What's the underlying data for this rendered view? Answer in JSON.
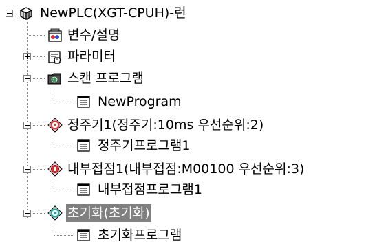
{
  "tree": {
    "root": {
      "label": "NewPLC(XGT-CPUH)-런",
      "icon": "plc-cube-icon"
    },
    "items": [
      {
        "label": "변수/설명",
        "icon": "variable-comment-icon"
      },
      {
        "label": "파라미터",
        "icon": "parameter-icon"
      },
      {
        "label": "스캔 프로그램",
        "icon": "scan-program-folder-icon"
      },
      {
        "label": "NewProgram",
        "icon": "program-icon"
      },
      {
        "label": "정주기1(정주기:10ms 우선순위:2)",
        "icon": "periodic-task-icon"
      },
      {
        "label": "정주기프로그램1",
        "icon": "program-icon"
      },
      {
        "label": "내부접점1(내부접점:M00100 우선순위:3)",
        "icon": "internal-contact-task-icon"
      },
      {
        "label": "내부접점프로그램1",
        "icon": "program-icon"
      },
      {
        "label": "초기화(초기화)",
        "icon": "init-task-icon",
        "selected": true
      },
      {
        "label": "초기화프로그램",
        "icon": "program-icon"
      }
    ]
  },
  "colors": {
    "selection_bg": "#808080",
    "tree_lines": "#808080",
    "periodic_red": "#e03030",
    "init_teal": "#20a0a0",
    "scan_green": "#30a050"
  }
}
